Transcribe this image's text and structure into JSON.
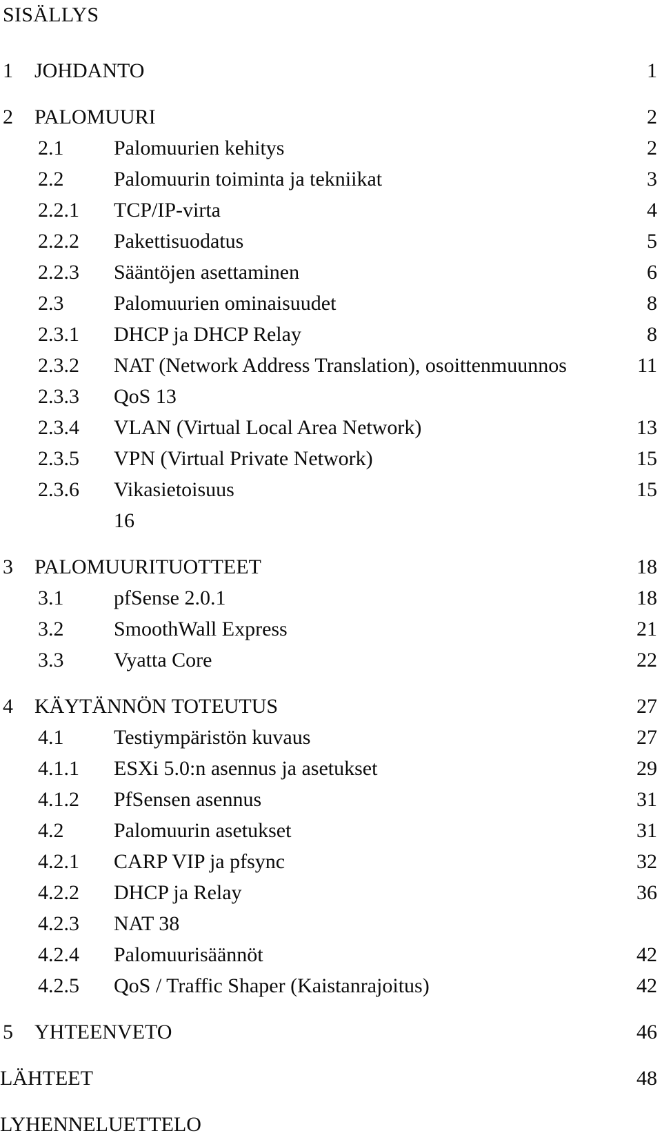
{
  "document": {
    "title": "SISÄLLYS"
  },
  "toc": {
    "entries": [
      {
        "number": "1",
        "label": "JOHDANTO",
        "page": "1",
        "level": 1,
        "gap": true
      },
      {
        "number": "2",
        "label": "PALOMUURI",
        "page": "2",
        "level": 1,
        "gap": true
      },
      {
        "number": "2.1",
        "label": "Palomuurien kehitys",
        "page": "2",
        "level": 2,
        "gap": false
      },
      {
        "number": "2.2",
        "label": "Palomuurin toiminta ja tekniikat",
        "page": "3",
        "level": 2,
        "gap": false
      },
      {
        "number": "2.2.1",
        "label": "TCP/IP-virta",
        "page": "4",
        "level": 2,
        "gap": false
      },
      {
        "number": "2.2.2",
        "label": "Pakettisuodatus",
        "page": "5",
        "level": 2,
        "gap": false
      },
      {
        "number": "2.2.3",
        "label": "Sääntöjen asettaminen",
        "page": "6",
        "level": 2,
        "gap": false
      },
      {
        "number": "2.3",
        "label": "Palomuurien ominaisuudet",
        "page": "8",
        "level": 2,
        "gap": false
      },
      {
        "number": "2.3.1",
        "label": "DHCP ja DHCP Relay",
        "page": "8",
        "level": 2,
        "gap": false
      },
      {
        "number": "2.3.2",
        "label": "NAT (Network Address Translation), osoittenmuunnos",
        "page": "11",
        "level": 2,
        "gap": false
      },
      {
        "number": "2.3.3",
        "label": "QoS  13",
        "page": "",
        "level": 2,
        "gap": false
      },
      {
        "number": "2.3.4",
        "label": "VLAN (Virtual Local Area Network)",
        "page": "13",
        "level": 2,
        "gap": false
      },
      {
        "number": "2.3.5",
        "label": "VPN (Virtual Private Network)",
        "page": "15",
        "level": 2,
        "gap": false
      },
      {
        "number": "2.3.6",
        "label": "Vikasietoisuus",
        "page": "15",
        "level": 2,
        "gap": false
      },
      {
        "number": "",
        "label": "16",
        "page": "",
        "level": 2,
        "gap": false
      },
      {
        "number": "3",
        "label": "PALOMUURITUOTTEET",
        "page": "18",
        "level": 1,
        "gap": true
      },
      {
        "number": "3.1",
        "label": "pfSense 2.0.1",
        "page": "18",
        "level": 2,
        "gap": false
      },
      {
        "number": "3.2",
        "label": "SmoothWall Express",
        "page": "21",
        "level": 2,
        "gap": false
      },
      {
        "number": "3.3",
        "label": "Vyatta Core",
        "page": "22",
        "level": 2,
        "gap": false
      },
      {
        "number": "4",
        "label": "KÄYTÄNNÖN TOTEUTUS",
        "page": "27",
        "level": 1,
        "gap": true
      },
      {
        "number": "4.1",
        "label": "Testiympäristön kuvaus",
        "page": "27",
        "level": 2,
        "gap": false
      },
      {
        "number": "4.1.1",
        "label": "ESXi 5.0:n asennus ja asetukset",
        "page": "29",
        "level": 2,
        "gap": false
      },
      {
        "number": "4.1.2",
        "label": "PfSensen asennus",
        "page": "31",
        "level": 2,
        "gap": false
      },
      {
        "number": "4.2",
        "label": "Palomuurin asetukset",
        "page": "31",
        "level": 2,
        "gap": false
      },
      {
        "number": "4.2.1",
        "label": "CARP VIP ja pfsync",
        "page": "32",
        "level": 2,
        "gap": false
      },
      {
        "number": "4.2.2",
        "label": "DHCP ja Relay",
        "page": "36",
        "level": 2,
        "gap": false
      },
      {
        "number": "4.2.3",
        "label": "NAT 38",
        "page": "",
        "level": 2,
        "gap": false
      },
      {
        "number": "4.2.4",
        "label": "Palomuurisäännöt",
        "page": "42",
        "level": 2,
        "gap": false
      },
      {
        "number": "4.2.5",
        "label": "QoS / Traffic Shaper (Kaistanrajoitus)",
        "page": "42",
        "level": 2,
        "gap": false
      },
      {
        "number": "5",
        "label": "YHTEENVETO",
        "page": "46",
        "level": 1,
        "gap": true
      },
      {
        "number": "",
        "label": "LÄHTEET",
        "page": "48",
        "level": 1,
        "gap": true,
        "flush": true
      },
      {
        "number": "",
        "label": "LYHENNELUETTELO",
        "page": "",
        "level": 1,
        "gap": true,
        "flush": true
      }
    ]
  }
}
